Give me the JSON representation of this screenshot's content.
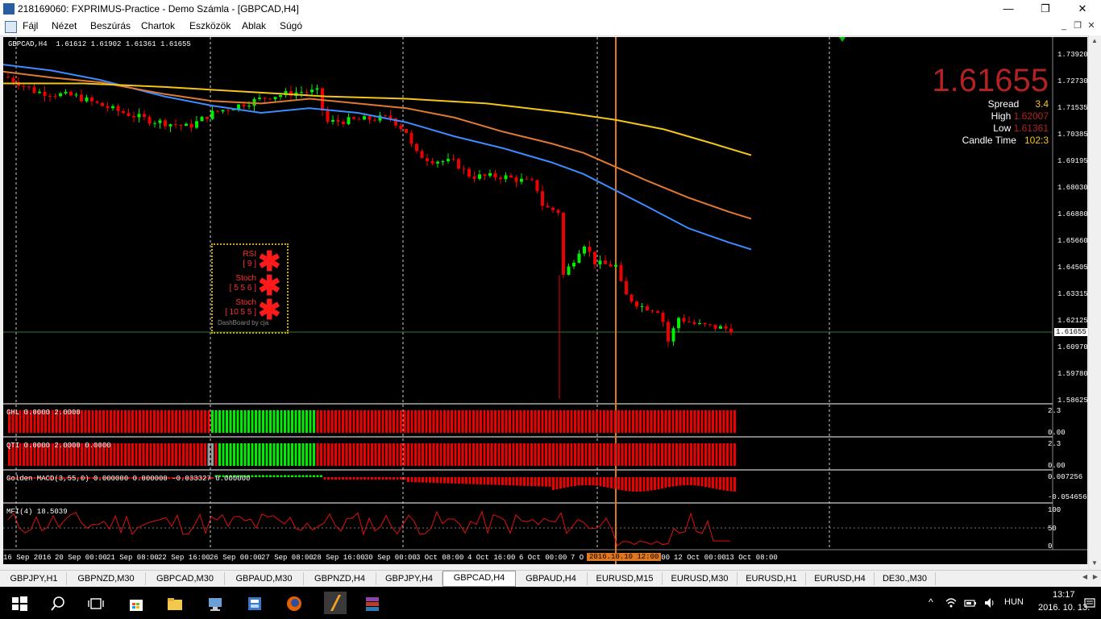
{
  "window": {
    "title": "218169060: FXPRIMUS-Practice - Demo Számla - [GBPCAD,H4]",
    "minimize": "—",
    "maximize": "❐",
    "close": "✕"
  },
  "menu": {
    "items": [
      "Fájl",
      "Nézet",
      "Beszúrás",
      "Chartok",
      "Eszközök",
      "Ablak",
      "Súgó"
    ]
  },
  "chart": {
    "symbol_header": "GBPCAD,H4  1.61612 1.61902 1.61361 1.61655",
    "current_price_tag": "1.61655",
    "price_axis": [
      "1.73920",
      "1.72730",
      "1.71535",
      "1.70385",
      "1.69195",
      "1.68030",
      "1.66880",
      "1.65660",
      "1.64505",
      "1.63315",
      "1.62125",
      "1.60970",
      "1.59780",
      "1.58625"
    ],
    "time_axis": [
      "16 Sep 2016",
      "20 Sep 00:00",
      "21 Sep 08:00",
      "22 Sep 16:00",
      "26 Sep 00:00",
      "27 Sep 08:00",
      "28 Sep 16:00",
      "30 Sep 00:00",
      "3 Oct 08:00",
      "4 Oct 16:00",
      "6 Oct 00:00",
      "7 O",
      "16:00",
      "12 Oct 00:00",
      "13 Oct 08:00"
    ],
    "crosshair_time": "2016.10.10 12:00",
    "colors": {
      "bull": "#00ee00",
      "bear": "#ee0000",
      "ma_blue": "#3c8cff",
      "ma_orange": "#e07a32",
      "ma_yellow": "#f5c518",
      "crosshair": "#e07820",
      "bid_line": "#2e7d32"
    }
  },
  "info": {
    "bid": "1.61655",
    "spread_label": "Spread",
    "spread_value": "3.4",
    "high_label": "High",
    "high_value": "1.62007",
    "low_label": "Low",
    "low_value": "1.61361",
    "candle_label": "Candle Time",
    "candle_value": "102:3"
  },
  "dashboard": {
    "rows": [
      {
        "name": "RSI",
        "params": "[ 9 ]"
      },
      {
        "name": "Stoch",
        "params": "[ 5 5 6 ]"
      },
      {
        "name": "Stoch",
        "params": "[ 10 5 5 ]"
      }
    ],
    "star": "✱",
    "footer": "DashBoard by cja"
  },
  "subwindows": {
    "ghl": {
      "label": "GHL 0.0000 2.0000",
      "axis_top": "2.3",
      "axis_bottom": "0.00",
      "axis_bottom2": "0.00"
    },
    "qti": {
      "label": "QTI 0.0000 2.0000 0.0000",
      "axis_top": "2.3",
      "axis_bottom": "0.00",
      "axis_bottom2": "0.00"
    },
    "macd": {
      "label": "Golden MACD(3,55,0) 0.000000 0.000000 -0.033327 0.000000",
      "axis_top": "0.007256",
      "axis_bottom": "-0.054656"
    },
    "mfi": {
      "label": "MFI(4) 18.5039",
      "axis_top": "100",
      "axis_mid": "50",
      "axis_bottom": "0"
    }
  },
  "tabs": [
    "GBPJPY,H1",
    "GBPNZD,M30",
    "GBPCAD,M30",
    "GBPAUD,M30",
    "GBPNZD,H4",
    "GBPJPY,H4",
    "GBPCAD,H4",
    "GBPAUD,H4",
    "EURUSD,M15",
    "EURUSD,M30",
    "EURUSD,H1",
    "EURUSD,H4",
    "DE30.,M30"
  ],
  "active_tab": 6,
  "taskbar": {
    "language": "HUN",
    "time": "13:17",
    "date": "2016. 10. 13."
  }
}
